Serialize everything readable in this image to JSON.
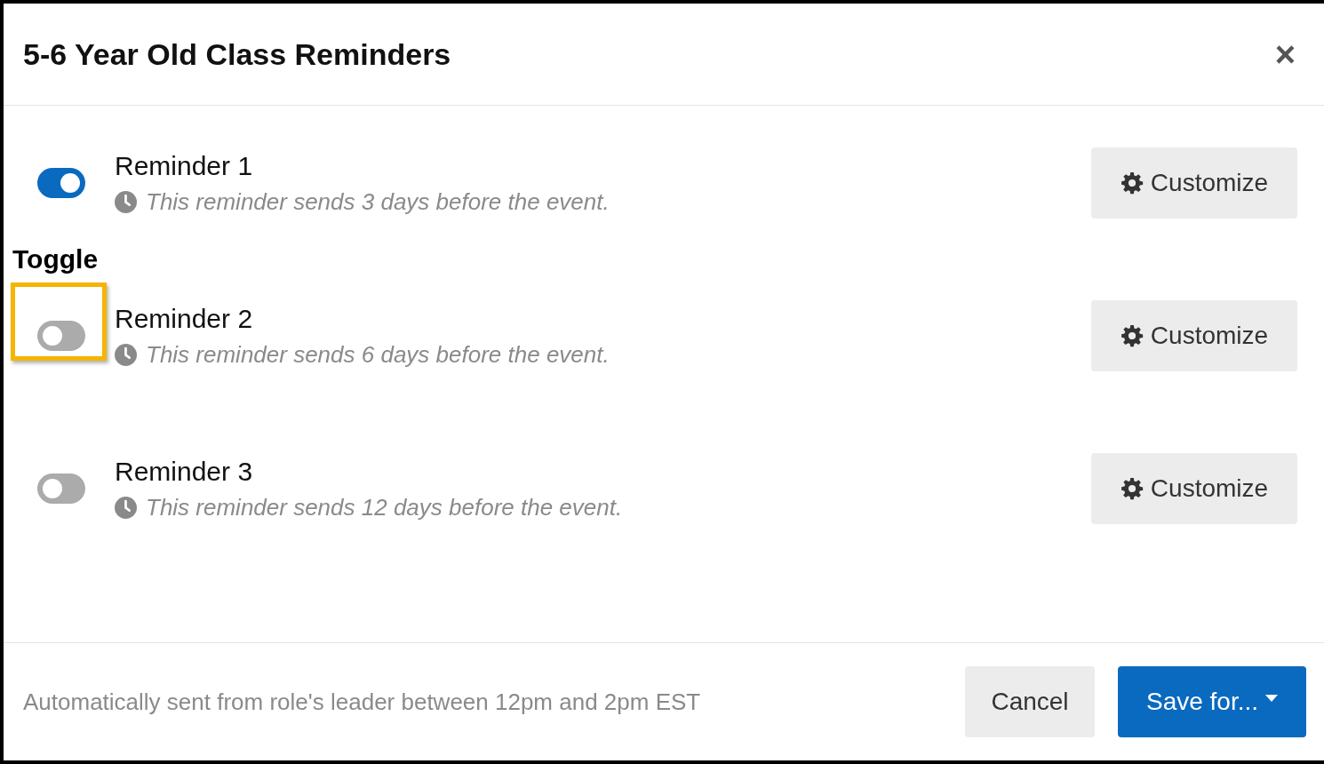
{
  "dialog": {
    "title": "5-6 Year Old Class Reminders",
    "close": "×"
  },
  "reminders": [
    {
      "title": "Reminder 1",
      "description": "This reminder sends 3 days before the event.",
      "on": true,
      "button": "Customize"
    },
    {
      "title": "Reminder 2",
      "description": "This reminder sends 6 days before the event.",
      "on": false,
      "button": "Customize",
      "callout": "Toggle"
    },
    {
      "title": "Reminder 3",
      "description": "This reminder sends 12 days before the event.",
      "on": false,
      "button": "Customize"
    }
  ],
  "footer": {
    "note": "Automatically sent from role's leader between 12pm and 2pm EST",
    "cancel": "Cancel",
    "save": "Save for..."
  }
}
